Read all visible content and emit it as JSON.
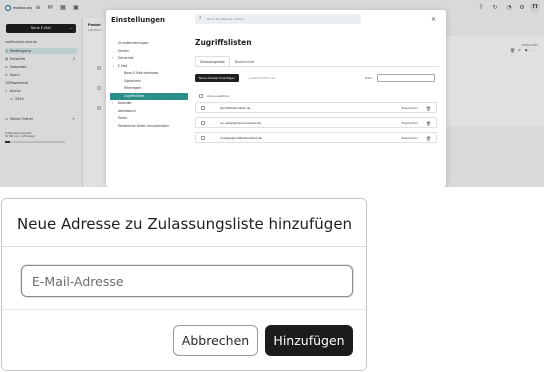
{
  "background_app": {
    "logo": "mailbox.org",
    "topbar_icons": [
      "menu-icon",
      "mail-icon",
      "calendar-icon",
      "contacts-icon"
    ],
    "topbar_right_icons": [
      "help-icon",
      "refresh-icon",
      "notifications-icon",
      "settings-icon"
    ],
    "user_initials": "TT",
    "sidebar": {
      "new_mail_label": "Neue E-Mail",
      "account": "notifications-test.de",
      "folders": [
        {
          "label": "Posteingang",
          "count": ""
        },
        {
          "label": "Entwürfe",
          "count": "2"
        },
        {
          "label": "Gesendet",
          "count": ""
        },
        {
          "label": "Spam",
          "count": ""
        },
        {
          "label": "Papierkorb",
          "count": ""
        },
        {
          "label": "Archiv",
          "count": ""
        },
        {
          "label": "2024",
          "count": ""
        },
        {
          "label": "Meine Ordner",
          "count": ""
        }
      ],
      "quota_line1": "E-Mail-Speicherplatz",
      "quota_line2": "10 MB von 1 GB belegt",
      "quota_fraction": 0.08
    },
    "message_list": {
      "title": "Postei",
      "subtitle": "100 Nach"
    },
    "reader": {
      "date": "03.06.2024"
    }
  },
  "settings": {
    "title": "Einstellungen",
    "search_placeholder": "Nach Einstellung suchen",
    "nav": [
      {
        "label": "Grundeinstellungen",
        "level": 0,
        "active": false,
        "arrow": ""
      },
      {
        "label": "Konten",
        "level": 0,
        "active": false,
        "arrow": ""
      },
      {
        "label": "Sicherheit",
        "level": 0,
        "active": false,
        "arrow": "›"
      },
      {
        "label": "E-Mail",
        "level": 0,
        "active": false,
        "arrow": "⌄"
      },
      {
        "label": "Neue E-Mail verfassen",
        "level": 1,
        "active": false,
        "arrow": ""
      },
      {
        "label": "Signaturen",
        "level": 1,
        "active": false,
        "arrow": ""
      },
      {
        "label": "Filterregeln",
        "level": 1,
        "active": false,
        "arrow": ""
      },
      {
        "label": "Zugriffslisten",
        "level": 1,
        "active": true,
        "arrow": ""
      },
      {
        "label": "Kalender",
        "level": 0,
        "active": false,
        "arrow": "›"
      },
      {
        "label": "Adressbuch",
        "level": 0,
        "active": false,
        "arrow": ""
      },
      {
        "label": "Portal",
        "level": 0,
        "active": false,
        "arrow": ""
      },
      {
        "label": "Persönliche Daten herunterladen",
        "level": 0,
        "active": false,
        "arrow": ""
      }
    ],
    "pane_title": "Zugriffslisten",
    "tabs": [
      "Zulassungsliste",
      "Blockierliste"
    ],
    "add_button": "Neue Adresse hinzufügen",
    "remove_button": "Auswahl entfernen",
    "filter_label": "Filter:",
    "select_all": "Alle auswählen",
    "entries": [
      {
        "address": "@notificationtest.de",
        "edit": "Bearbeiten"
      },
      {
        "address": "no-reply@mail.ecobiquo.de",
        "edit": "Bearbeiten"
      },
      {
        "address": "noreply@notificationtest.de",
        "edit": "Bearbeiten"
      }
    ]
  },
  "dialog": {
    "title": "Neue Adresse zu Zulassungsliste hinzufügen",
    "email_placeholder": "E-Mail-Adresse",
    "email_value": "",
    "cancel_label": "Abbrechen",
    "submit_label": "Hinzufügen"
  }
}
